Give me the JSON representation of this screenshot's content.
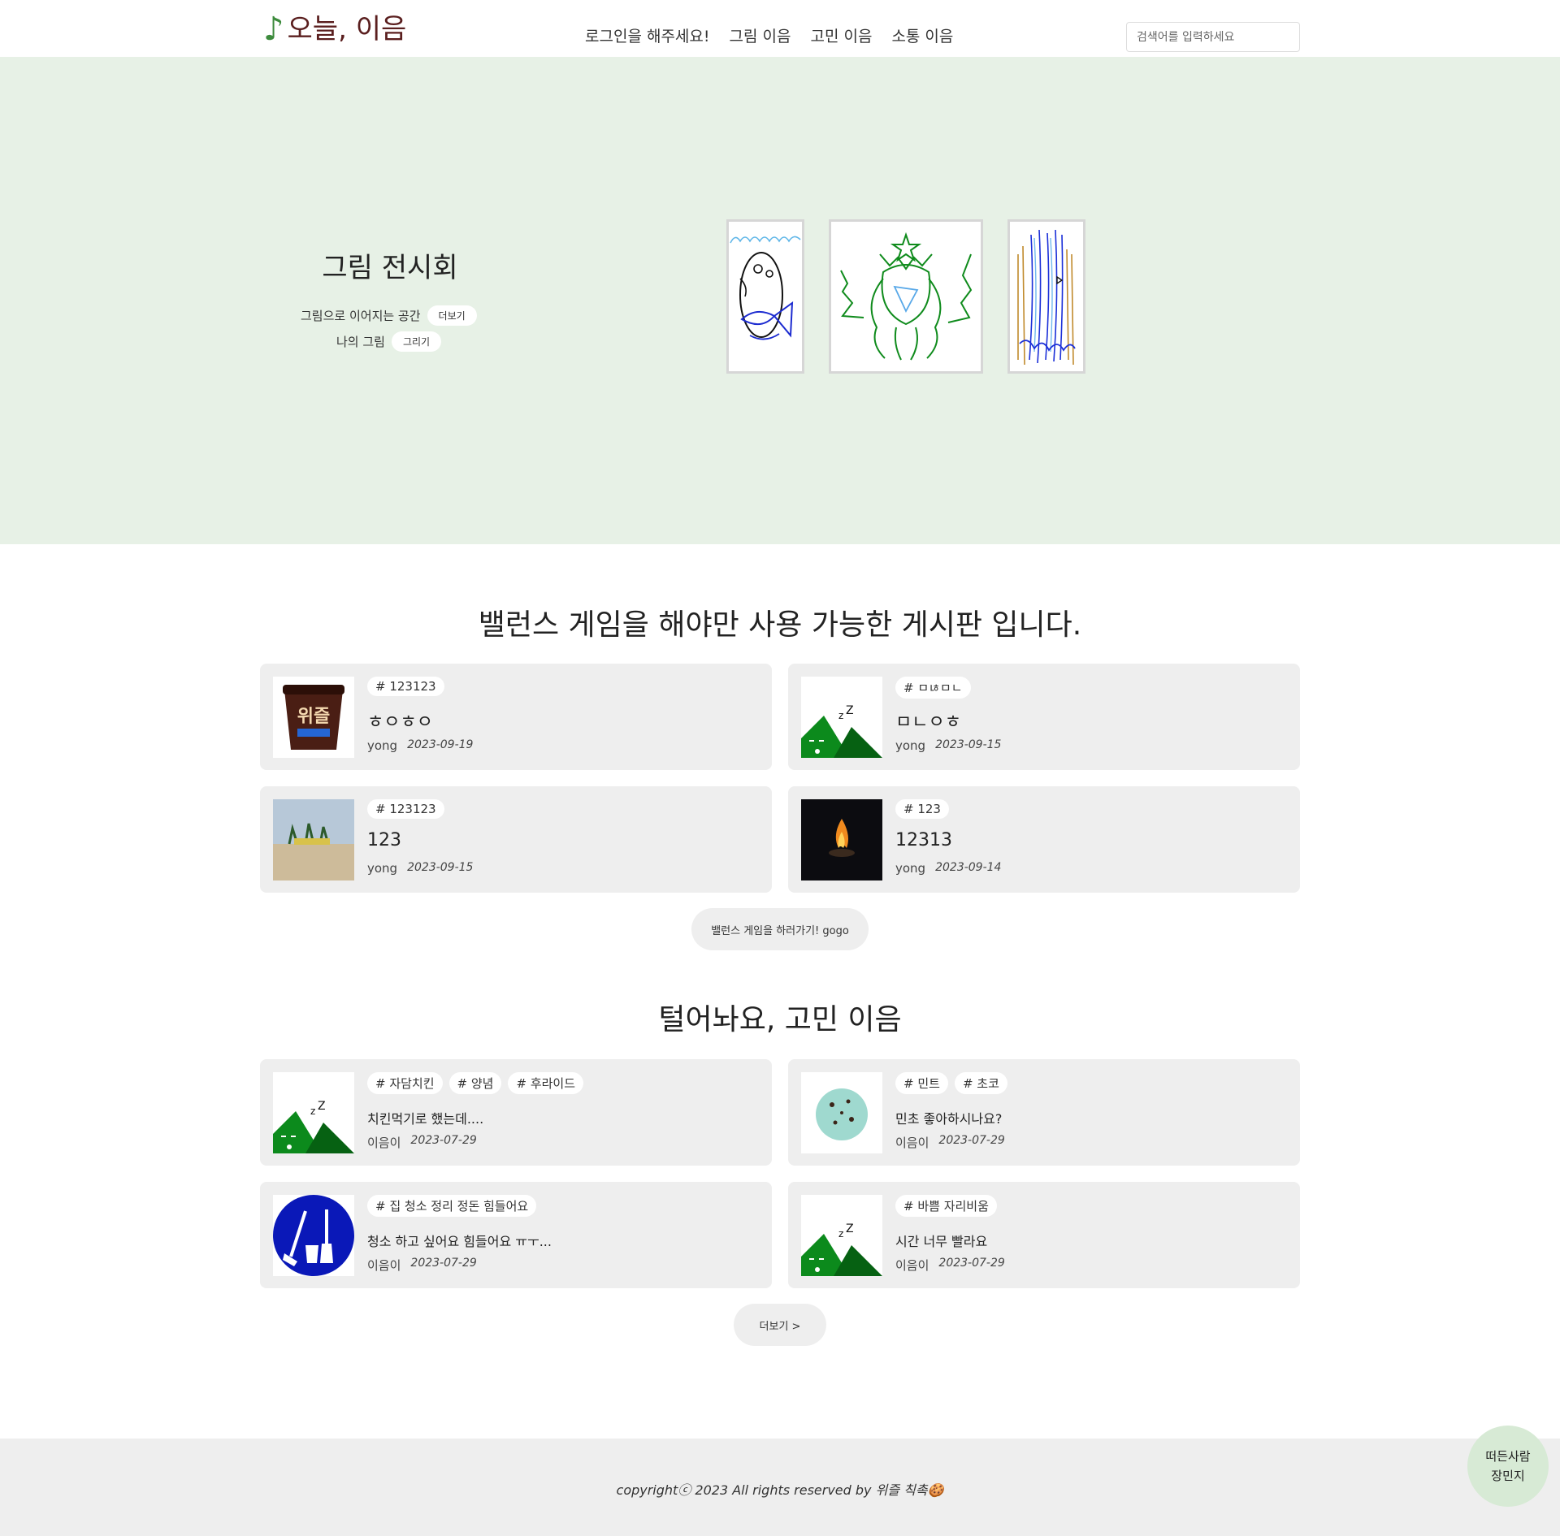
{
  "header": {
    "logo_note": "♪",
    "logo_text": "오늘, 이음",
    "nav": [
      "로그인을 해주세요!",
      "그림 이음",
      "고민 이음",
      "소통 이음"
    ],
    "search_placeholder": "검색어를 입력하세요"
  },
  "hero": {
    "title": "그림 전시회",
    "row1_text": "그림으로 이어지는 공간",
    "row1_button": "더보기",
    "row2_text": "나의 그림",
    "row2_button": "그리기",
    "background_color": "#e7f1e6"
  },
  "balance": {
    "title": "밸런스 게임을 해야만 사용 가능한 게시판 입니다.",
    "posts": [
      {
        "tags": [
          "# 123123"
        ],
        "title": "ㅎㅇㅎㅇ",
        "author": "yong",
        "date": "2023-09-19",
        "thumb": "ice-cream-cup-image"
      },
      {
        "tags": [
          "# ㅁㄶㅁㄴ"
        ],
        "title": "ㅁㄴㅇㅎ",
        "author": "yong",
        "date": "2023-09-15",
        "thumb": "sleeping-mountain-image"
      },
      {
        "tags": [
          "# 123123"
        ],
        "title": "123",
        "author": "yong",
        "date": "2023-09-15",
        "thumb": "beach-image"
      },
      {
        "tags": [
          "# 123"
        ],
        "title": "12313",
        "author": "yong",
        "date": "2023-09-14",
        "thumb": "campfire-image"
      }
    ],
    "button": "밸런스 게임을 하러가기! gogo"
  },
  "worry": {
    "title": "털어놔요, 고민 이음",
    "posts": [
      {
        "tags": [
          "# 자담치킨",
          "# 양념",
          "# 후라이드"
        ],
        "title": "치킨먹기로 했는데....",
        "author": "이음이",
        "date": "2023-07-29",
        "thumb": "sleeping-mountain-image"
      },
      {
        "tags": [
          "# 민트",
          "# 초코"
        ],
        "title": "민초 좋아하시나요?",
        "author": "이음이",
        "date": "2023-07-29",
        "thumb": "mint-ice-cream-image"
      },
      {
        "tags": [
          "# 집 청소 정리 정돈 힘들어요"
        ],
        "title": "청소 하고 싶어요 힘들어요 ㅠㅜ...",
        "author": "이음이",
        "date": "2023-07-29",
        "thumb": "cleaning-sign-image"
      },
      {
        "tags": [
          "# 바쁨 자리비움"
        ],
        "title": "시간 너무 빨라요",
        "author": "이음이",
        "date": "2023-07-29",
        "thumb": "sleeping-mountain-image"
      }
    ],
    "button": "더보기 >"
  },
  "footer": {
    "copyright": "copyrightⓒ 2023 All rights reserved by 위즐 칙촉🍪"
  },
  "float_button": {
    "line1": "떠든사람",
    "line2": "장민지"
  },
  "colors": {
    "logo_note": "#3d8b3d",
    "logo_text": "#5a1e1e",
    "card_bg": "#eeeeee",
    "float_bg": "#d7ead5"
  }
}
